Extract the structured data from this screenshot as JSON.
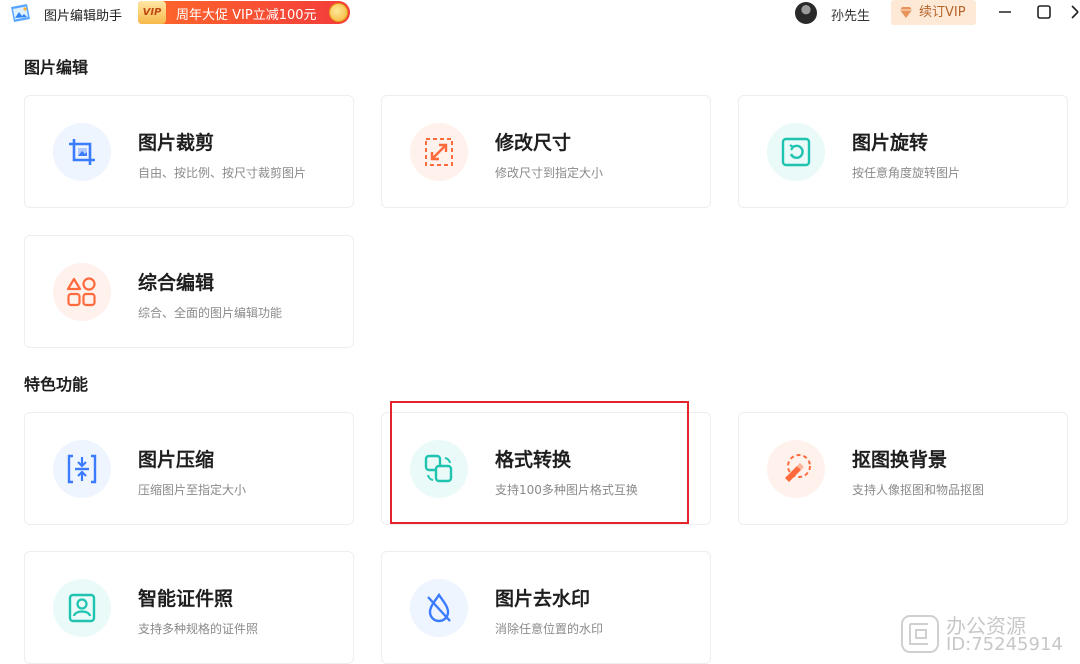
{
  "titlebar": {
    "app_title": "图片编辑助手",
    "promo_badge": "VIP",
    "promo_text": "周年大促 VIP立减100元",
    "username": "孙先生",
    "vip_button": "续订VIP"
  },
  "sections": [
    {
      "title": "图片编辑",
      "cards": [
        {
          "title": "图片裁剪",
          "desc": "自由、按比例、按尺寸裁剪图片",
          "icon": "crop-icon",
          "color": "#3b7cff"
        },
        {
          "title": "修改尺寸",
          "desc": "修改尺寸到指定大小",
          "icon": "resize-icon",
          "color": "#ff6a3d"
        },
        {
          "title": "图片旋转",
          "desc": "按任意角度旋转图片",
          "icon": "rotate-icon",
          "color": "#1fc4b0"
        },
        {
          "title": "综合编辑",
          "desc": "综合、全面的图片编辑功能",
          "icon": "shapes-icon",
          "color": "#ff6a3d"
        }
      ]
    },
    {
      "title": "特色功能",
      "cards": [
        {
          "title": "图片压缩",
          "desc": "压缩图片至指定大小",
          "icon": "compress-icon",
          "color": "#3b7cff"
        },
        {
          "title": "格式转换",
          "desc": "支持100多种图片格式互换",
          "icon": "convert-icon",
          "color": "#1fc4b0"
        },
        {
          "title": "抠图换背景",
          "desc": "支持人像抠图和物品抠图",
          "icon": "cutout-icon",
          "color": "#ff6a3d"
        },
        {
          "title": "智能证件照",
          "desc": "支持多种规格的证件照",
          "icon": "id-photo-icon",
          "color": "#1fc4b0"
        },
        {
          "title": "图片去水印",
          "desc": "消除任意位置的水印",
          "icon": "watermark-remove-icon",
          "color": "#3b7cff"
        }
      ]
    }
  ],
  "watermark": {
    "line1": "办公资源",
    "line2": "ID:75245914"
  }
}
